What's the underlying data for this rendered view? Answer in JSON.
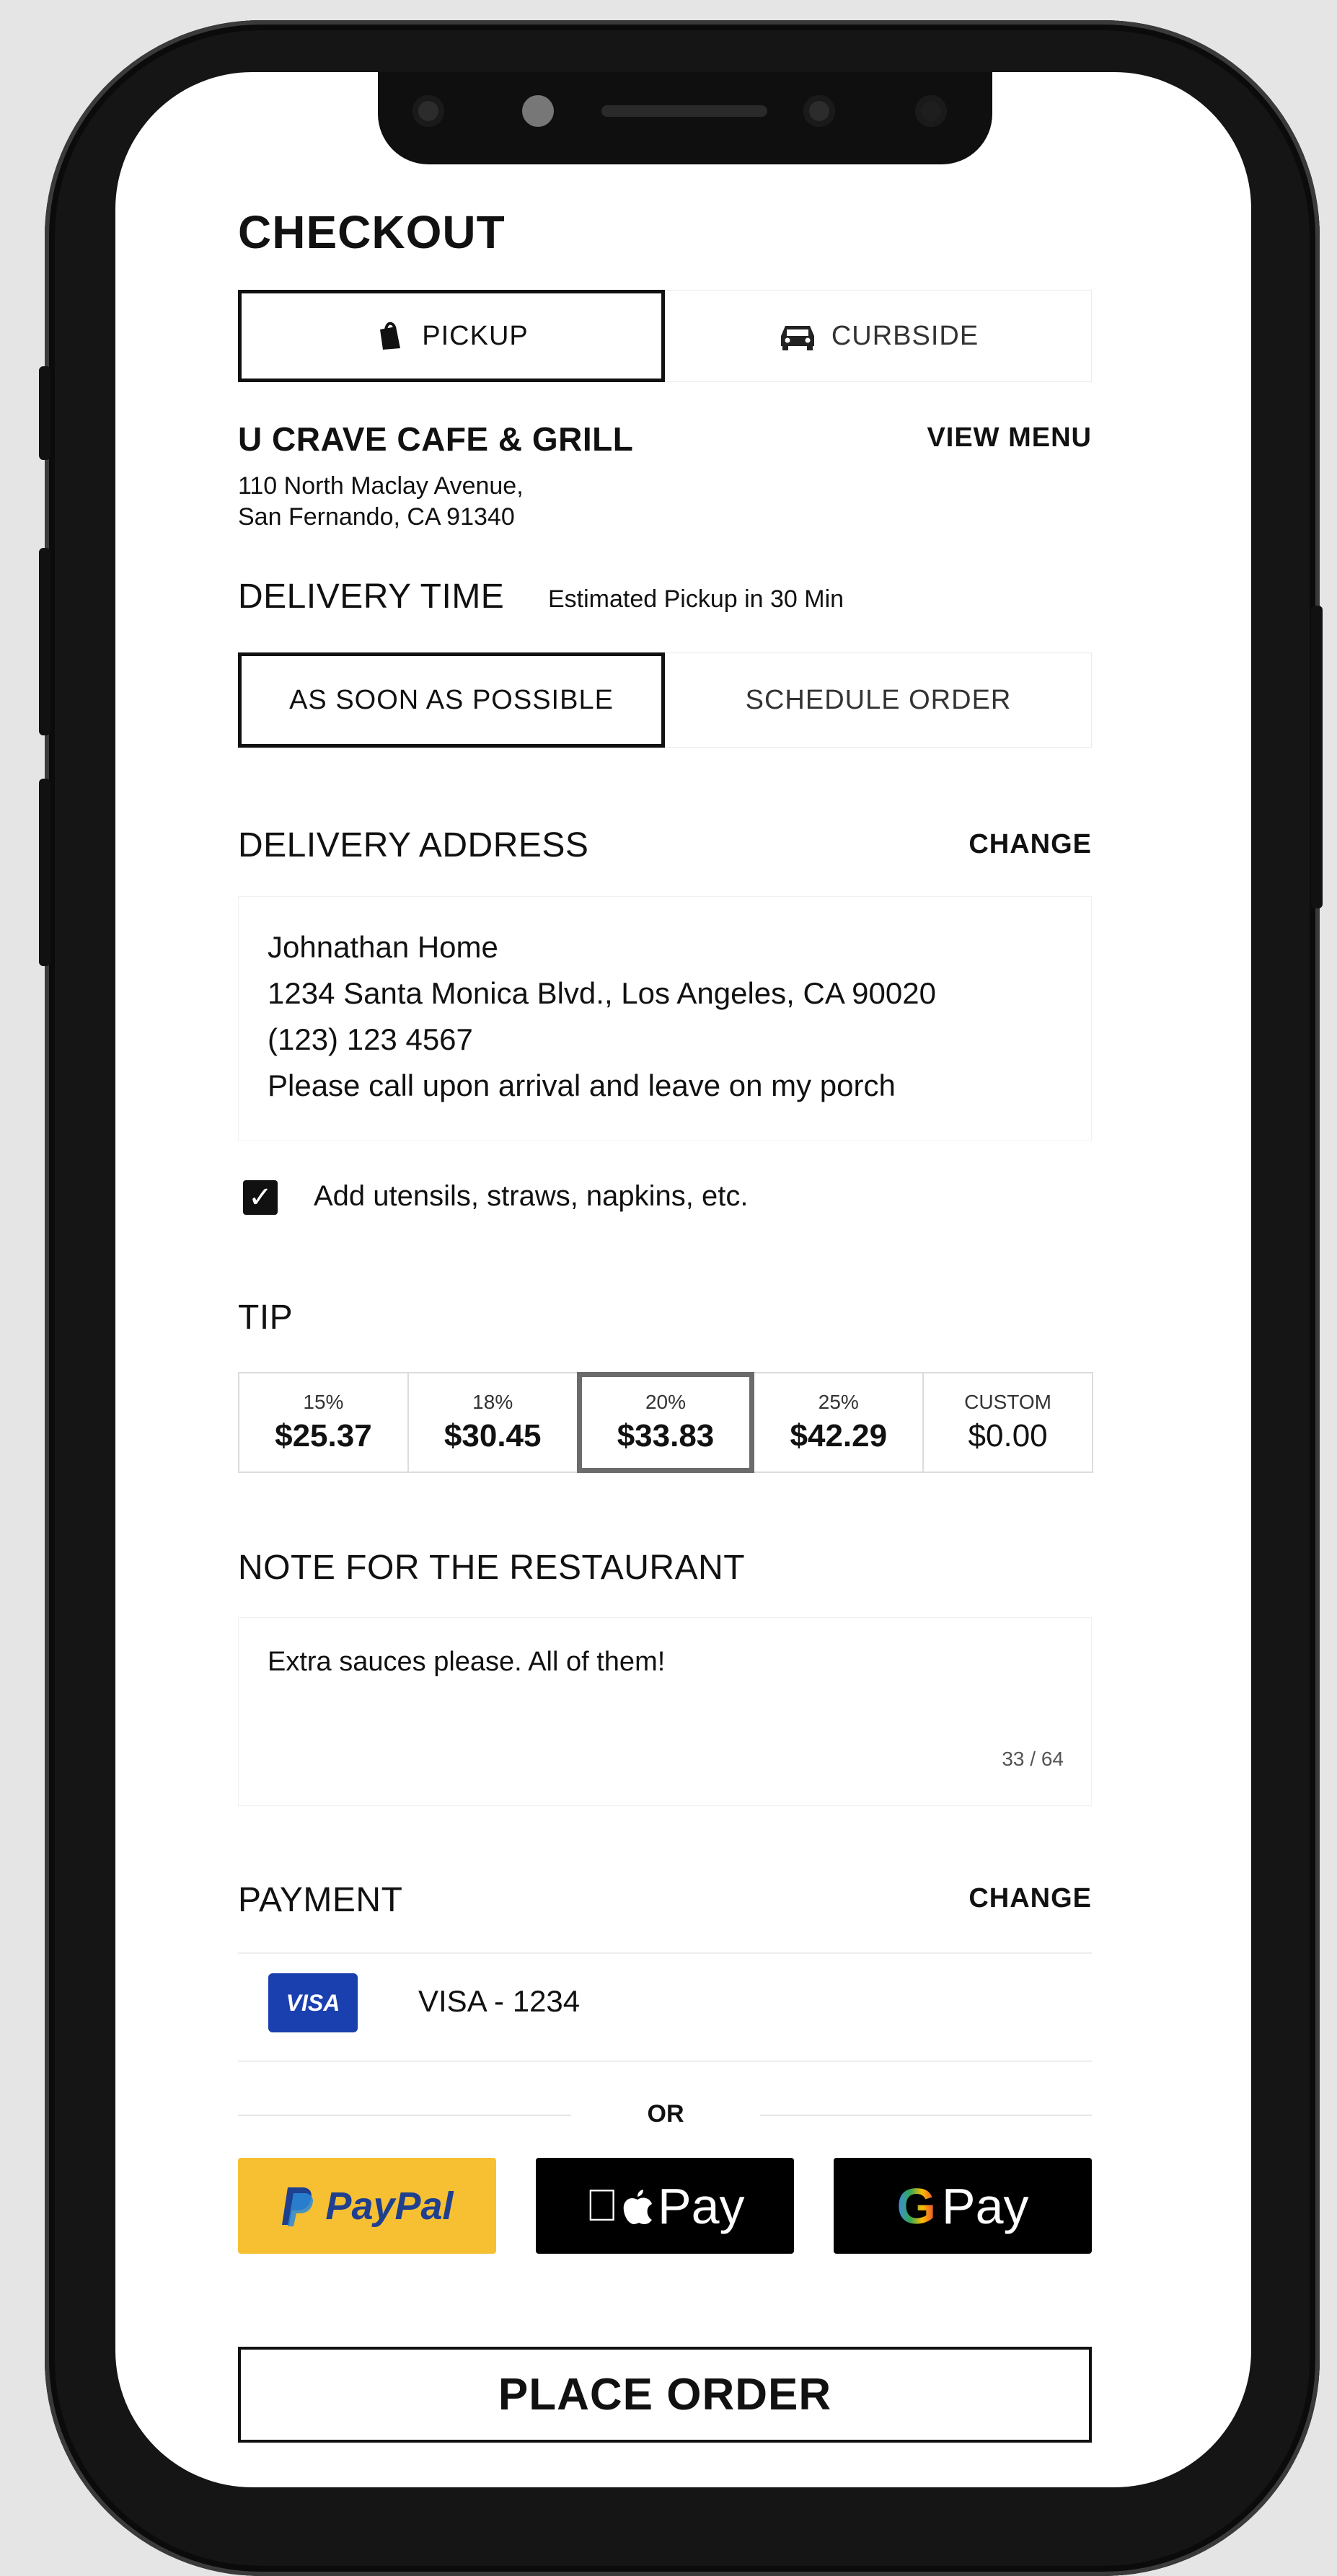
{
  "checkout": {
    "title": "CHECKOUT",
    "modes": [
      {
        "label": "PICKUP",
        "icon": "bag-icon",
        "selected": true
      },
      {
        "label": "CURBSIDE",
        "icon": "car-icon",
        "selected": false
      }
    ]
  },
  "restaurant": {
    "name": "U CRAVE CAFE & GRILL",
    "view_menu": "VIEW MENU",
    "address_line1": "110 North Maclay Avenue,",
    "address_line2": "San Fernando, CA 91340"
  },
  "delivery_time": {
    "heading": "DELIVERY TIME",
    "estimate": "Estimated Pickup in 30 Min",
    "options": [
      {
        "label": "AS SOON AS POSSIBLE",
        "selected": true
      },
      {
        "label": "SCHEDULE ORDER",
        "selected": false
      }
    ]
  },
  "delivery_address": {
    "heading": "DELIVERY ADDRESS",
    "change": "CHANGE",
    "name": "Johnathan Home",
    "street": "1234 Santa Monica Blvd., Los Angeles, CA 90020",
    "phone": "(123) 123 4567",
    "instructions": "Please call upon arrival and leave on my porch"
  },
  "utensils": {
    "checked": true,
    "label": "Add utensils, straws, napkins, etc."
  },
  "tip": {
    "heading": "TIP",
    "options": [
      {
        "pct": "15%",
        "amount": "$25.37",
        "selected": false
      },
      {
        "pct": "18%",
        "amount": "$30.45",
        "selected": false
      },
      {
        "pct": "20%",
        "amount": "$33.83",
        "selected": true
      },
      {
        "pct": "25%",
        "amount": "$42.29",
        "selected": false
      },
      {
        "pct": "CUSTOM",
        "amount": "$0.00",
        "selected": false
      }
    ]
  },
  "note": {
    "heading": "NOTE FOR THE RESTAURANT",
    "text": "Extra sauces please. All of them!",
    "counter": "33 / 64"
  },
  "payment": {
    "heading": "PAYMENT",
    "change": "CHANGE",
    "card_badge": "VISA",
    "card_label": "VISA - 1234",
    "or": "OR",
    "paypal": "PayPal",
    "apple_pay": "Pay",
    "google_pay": "Pay",
    "google_g": "G"
  },
  "place_order": "PLACE ORDER",
  "colors": {
    "paypal_bg": "#f7c033",
    "paypal_text": "#1f3f8f",
    "wallet_bg": "#000000",
    "visa_bg": "#1a3fae"
  }
}
